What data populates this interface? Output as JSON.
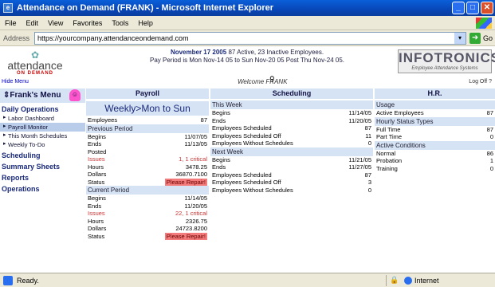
{
  "window": {
    "title": "Attendance on Demand (FRANK) - Microsoft Internet Explorer"
  },
  "menubar": [
    "File",
    "Edit",
    "View",
    "Favorites",
    "Tools",
    "Help"
  ],
  "address": {
    "label": "Address",
    "url": "https://yourcompany.attendanceondemand.com",
    "go": "Go"
  },
  "header": {
    "logo_name": "attendance",
    "logo_sub": "ON DEMAND",
    "hide_menu": "Hide Menu",
    "notice_date": "November 17 2005",
    "notice_rest": "87 Active, 23 Inactive Employees.",
    "notice_line2": "Pay Period is Mon Nov-14 05 to Sun Nov-20 05 Post Thu Nov-24 05.",
    "welcome": "Welcome FRANK",
    "brand": "INFOTRONICS",
    "brand_sub": "Employee Attendance Systems",
    "logoff": "Log Off"
  },
  "sidebar": {
    "title": "Frank's Menu",
    "sections": [
      {
        "label": "Daily Operations",
        "items": [
          "Labor Dashboard",
          "Payroll Monitor",
          "This Month Schedules",
          "Weekly To-Do"
        ]
      },
      {
        "label": "Scheduling",
        "items": []
      },
      {
        "label": "Summary Sheets",
        "items": []
      },
      {
        "label": "Reports",
        "items": []
      },
      {
        "label": "Operations",
        "items": []
      }
    ]
  },
  "columns": {
    "payroll": "Payroll",
    "scheduling": "Scheduling",
    "hr": "H.R."
  },
  "payroll": {
    "big_title": "Weekly>Mon to Sun",
    "employees_label": "Employees",
    "employees": "87",
    "previous": {
      "title": "Previous Period",
      "rows": [
        {
          "label": "Begins",
          "value": "11/07/05"
        },
        {
          "label": "Ends",
          "value": "11/13/05"
        },
        {
          "label": "Posted",
          "value": ""
        },
        {
          "label": "Issues",
          "value": "1, 1 critical"
        },
        {
          "label": "Hours",
          "value": "3478.25"
        },
        {
          "label": "Dollars",
          "value": "36870.7100"
        },
        {
          "label": "Status",
          "value": "Please Repair!"
        }
      ]
    },
    "current": {
      "title": "Current Period",
      "rows": [
        {
          "label": "Begins",
          "value": "11/14/05"
        },
        {
          "label": "Ends",
          "value": "11/20/05"
        },
        {
          "label": "Issues",
          "value": "22, 1 critical"
        },
        {
          "label": "Hours",
          "value": "2326.75"
        },
        {
          "label": "Dollars",
          "value": "24723.8200"
        },
        {
          "label": "Status",
          "value": "Please Repair!"
        }
      ]
    }
  },
  "scheduling": {
    "this_week": {
      "title": "This Week",
      "rows": [
        {
          "label": "Begins",
          "value": "11/14/05"
        },
        {
          "label": "Ends",
          "value": "11/20/05"
        },
        {
          "label": "Employees Scheduled",
          "value": "87"
        },
        {
          "label": "Employees Scheduled Off",
          "value": "11"
        },
        {
          "label": "Employees Without Schedules",
          "value": "0"
        }
      ]
    },
    "next_week": {
      "title": "Next Week",
      "rows": [
        {
          "label": "Begins",
          "value": "11/21/05"
        },
        {
          "label": "Ends",
          "value": "11/27/05"
        },
        {
          "label": "Employees Scheduled",
          "value": "87"
        },
        {
          "label": "Employees Scheduled Off",
          "value": "3"
        },
        {
          "label": "Employees Without Schedules",
          "value": "0"
        }
      ]
    }
  },
  "hr": {
    "usage": {
      "title": "Usage",
      "rows": [
        {
          "label": "Active Employees",
          "value": "87"
        }
      ]
    },
    "hourly": {
      "title": "Hourly Status Types",
      "rows": [
        {
          "label": "Full Time",
          "value": "87"
        },
        {
          "label": "Part Time",
          "value": "0"
        }
      ]
    },
    "conditions": {
      "title": "Active Conditions",
      "rows": [
        {
          "label": "Normal",
          "value": "86"
        },
        {
          "label": "Probation",
          "value": "1"
        },
        {
          "label": "Training",
          "value": "0"
        }
      ]
    }
  },
  "statusbar": {
    "status": "Ready.",
    "zone": "Internet"
  },
  "colors": {
    "header_blue": "#d6e3f5",
    "repair_red": "#f47b7b",
    "issue_red": "#c33"
  }
}
